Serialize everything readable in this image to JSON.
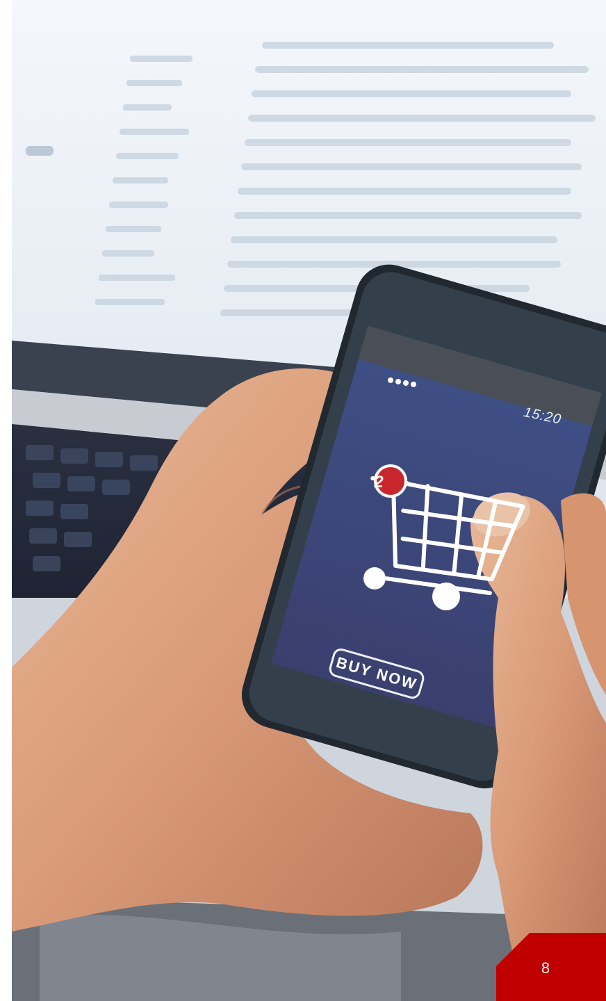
{
  "phone": {
    "status_dots": "●●●●",
    "time": "15:20",
    "cart_badge": "2",
    "button_label": "BUY NOW"
  },
  "page": {
    "number": "8"
  },
  "colors": {
    "accent_red": "#c00000",
    "phone_screen": "#3a4a7a",
    "badge_red": "#c9252c"
  },
  "icons": [
    "shopping-cart-icon"
  ]
}
